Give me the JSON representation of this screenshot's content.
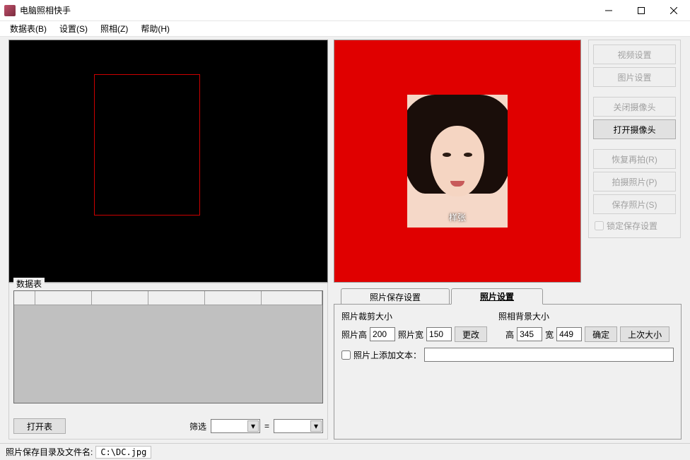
{
  "window": {
    "title": "电脑照相快手"
  },
  "menu": {
    "data": "数据表(B)",
    "settings": "设置(S)",
    "camera": "照相(Z)",
    "help": "帮助(H)"
  },
  "preview": {
    "sample_label": "样张"
  },
  "side": {
    "video_settings": "视频设置",
    "image_settings": "图片设置",
    "close_camera": "关闭摄像头",
    "open_camera": "打开摄像头",
    "retry": "恢复再拍(R)",
    "capture": "拍摄照片(P)",
    "save": "保存照片(S)",
    "lock_save": "锁定保存设置"
  },
  "data_group": {
    "legend": "数据表",
    "open_table": "打开表",
    "filter_label": "筛选",
    "eq": "="
  },
  "tabs": {
    "save_settings": "照片保存设置",
    "photo_settings": "照片设置"
  },
  "photo_settings": {
    "crop_section": "照片裁剪大小",
    "bg_section": "照相背景大小",
    "height_label": "照片高",
    "height_value": "200",
    "width_label": "照片宽",
    "width_value": "150",
    "change_btn": "更改",
    "bg_h_label": "高",
    "bg_h_value": "345",
    "bg_w_label": "宽",
    "bg_w_value": "449",
    "confirm_btn": "确定",
    "last_size_btn": "上次大小",
    "add_text_label": "照片上添加文本："
  },
  "status": {
    "label": "照片保存目录及文件名:",
    "path": "C:\\DC.jpg"
  }
}
